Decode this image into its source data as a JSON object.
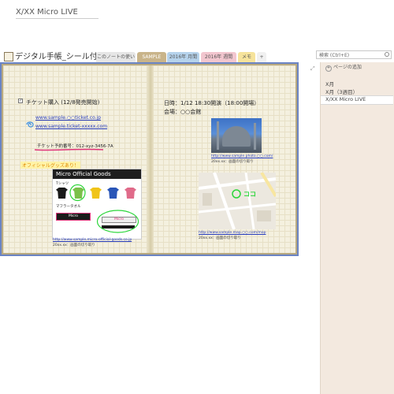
{
  "notebook": {
    "title": "デジタル手帳_シール付き",
    "tabs": [
      "このノートの使い方",
      "SAMPLE",
      "2016年 月間",
      "2016年 週間",
      "メモ",
      "+"
    ]
  },
  "search": {
    "placeholder": "検索 (Ctrl+E)"
  },
  "page": {
    "title": "X/XX Micro  LIVE",
    "left": {
      "ticket_heading": "チケット購入 (12/8発売開始)",
      "link1": "www.sample.○○ticket.co.jp",
      "link2": "www.sample.ticket-xxxxx.com",
      "reservation": "チケット予約番号：012-xyz-3456-7A",
      "goods_note": "オフィシャルグッズあり！",
      "goods_image": {
        "header": "Micro Official Goods",
        "tshirt_label": "Tシャツ",
        "towel_label": "マフラータオル",
        "towel1": "Micro",
        "towel2": "Micro"
      },
      "goods_link": "http://www.sample.micro-official-goods.co.jp",
      "goods_clip": "20xx.xx：画面の切り取り"
    },
    "right": {
      "datetime": "日時：1/12  18:30開演（18:00開場）",
      "venue": "会場：○○会館",
      "photo_link": "http://www.sample.photo.○○.com/",
      "photo_clip": "20xx.xx：画面の切り取り",
      "map_label": "ココ",
      "map_link": "http://www.sample.map.○○.com/map",
      "map_clip": "20xx.xx：画面の切り取り"
    }
  },
  "sidebar": {
    "add_page": "ページの追加",
    "pages": [
      "X月",
      "X月（3週目）",
      "X/XX Micro  LIVE"
    ]
  },
  "colors": {
    "tab_usage": "#e6e6e6",
    "tab_sample": "#c9b48a",
    "tab_monthly": "#b6d3ec",
    "tab_weekly": "#f2c6cf",
    "tab_memo": "#f6e39b",
    "accent_blue": "#6a84c4"
  },
  "shirt_colors": [
    "#1a1a1a",
    "#7ac04a",
    "#f0c419",
    "#2a56b8",
    "#e06b8a"
  ]
}
